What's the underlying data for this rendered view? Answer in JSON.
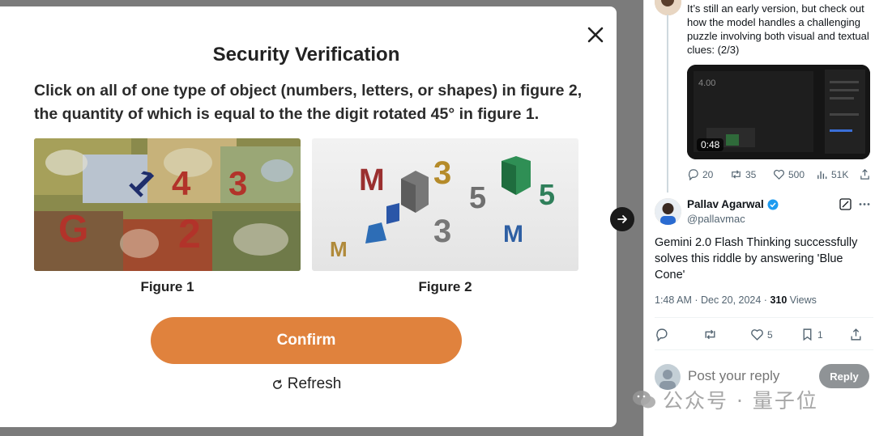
{
  "modal": {
    "title": "Security Verification",
    "instruction": "Click on all of one type of object (numbers, letters, or shapes) in figure 2, the quantity of which is equal to the the digit rotated 45° in figure 1.",
    "figure1_label": "Figure 1",
    "figure2_label": "Figure 2",
    "figure1_glyphs": [
      "G",
      "1",
      "4",
      "3",
      "2"
    ],
    "figure2_glyphs": [
      "M",
      "3",
      "5",
      "5",
      "3",
      "M",
      "M"
    ],
    "confirm_label": "Confirm",
    "refresh_label": "Refresh"
  },
  "prev_tweet": {
    "text": "It’s still an early version, but check out how the model handles a challenging puzzle involving both visual and textual clues: (2/3)",
    "video_duration": "0:48",
    "video_overlay_number": "4.00",
    "replies": "20",
    "reposts": "35",
    "likes": "500",
    "views": "51K"
  },
  "tweet": {
    "author_name": "Pallav Agarwal",
    "author_handle": "@pallavmac",
    "text": "Gemini 2.0 Flash Thinking successfully solves this riddle by answering 'Blue Cone'",
    "time": "1:48 AM · Dec 20, 2024 · ",
    "views_count": "310",
    "views_label": " Views",
    "likes": "5",
    "bookmarks": "1"
  },
  "reply": {
    "placeholder": "Post your reply",
    "button_label": "Reply"
  },
  "watermark": "公众号 · 量子位",
  "colors": {
    "confirm": "#e0823d",
    "verified": "#1d9bf0",
    "backdrop": "#7b7b7b"
  }
}
